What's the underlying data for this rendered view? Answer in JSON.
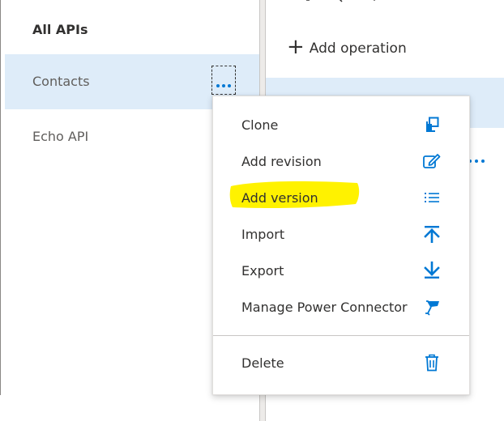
{
  "sidebar": {
    "header": "All APIs",
    "items": [
      {
        "label": "Contacts",
        "selected": true
      },
      {
        "label": "Echo API",
        "selected": false
      }
    ]
  },
  "operations": {
    "add_operation_label": "Add operation"
  },
  "context_menu": {
    "items": [
      {
        "label": "Clone",
        "icon": "clone-icon"
      },
      {
        "label": "Add revision",
        "icon": "edit-icon"
      },
      {
        "label": "Add version",
        "icon": "list-icon",
        "highlighted": true
      },
      {
        "label": "Import",
        "icon": "import-arrow-up-icon"
      },
      {
        "label": "Export",
        "icon": "export-arrow-down-icon"
      },
      {
        "label": "Manage Power Connector",
        "icon": "power-connector-icon"
      },
      {
        "label": "Delete",
        "icon": "trash-icon"
      }
    ]
  },
  "colors": {
    "accent": "#0078d4",
    "selected_bg": "#deecf9",
    "highlight": "#fff200"
  }
}
